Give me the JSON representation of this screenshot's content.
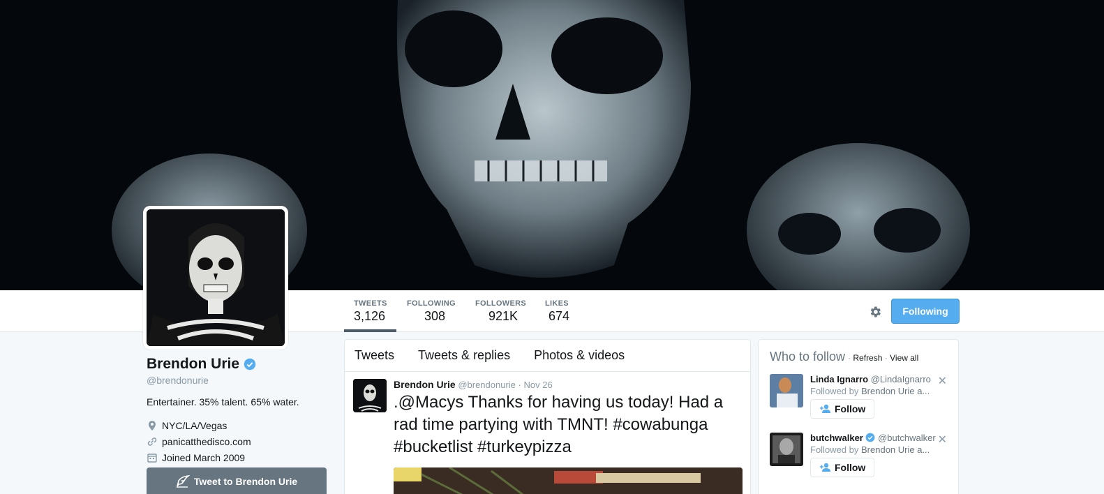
{
  "profile": {
    "name": "Brendon Urie",
    "handle": "@brendonurie",
    "bio": "Entertainer. 35% talent. 65% water.",
    "location": "NYC/LA/Vegas",
    "website": "panicatthedisco.com",
    "joined": "Joined March 2009",
    "tweet_to_label": "Tweet to Brendon Urie"
  },
  "stats": [
    {
      "label": "TWEETS",
      "value": "3,126"
    },
    {
      "label": "FOLLOWING",
      "value": "308"
    },
    {
      "label": "FOLLOWERS",
      "value": "921K"
    },
    {
      "label": "LIKES",
      "value": "674"
    }
  ],
  "following_button": "Following",
  "tabs": [
    "Tweets",
    "Tweets & replies",
    "Photos & videos"
  ],
  "tweet": {
    "name": "Brendon Urie",
    "handle": "@brendonurie",
    "sep": "·",
    "date": "Nov 26",
    "text_prefix": ".",
    "mention": "@Macys",
    "text": " Thanks for having us today! Had a rad time partying with TMNT! ",
    "hashtags": "#cowabunga #bucketlist #turkeypizza"
  },
  "who_to_follow": {
    "title": "Who to follow",
    "sep1": "·",
    "refresh": "Refresh",
    "sep2": "·",
    "view_all": "View all",
    "suggestions": [
      {
        "name": "Linda Ignarro",
        "handle": "@LindaIgnarro",
        "followed_by": "Followed by",
        "followed_name": "Brendon Urie a...",
        "follow_label": "Follow",
        "close": "✕"
      },
      {
        "name": "butchwalker",
        "handle": "@butchwalker",
        "followed_by": "Followed by",
        "followed_name": "Brendon Urie a...",
        "follow_label": "Follow",
        "close": "✕"
      }
    ]
  },
  "colors": {
    "accent": "#55acee",
    "link": "#14171a"
  }
}
